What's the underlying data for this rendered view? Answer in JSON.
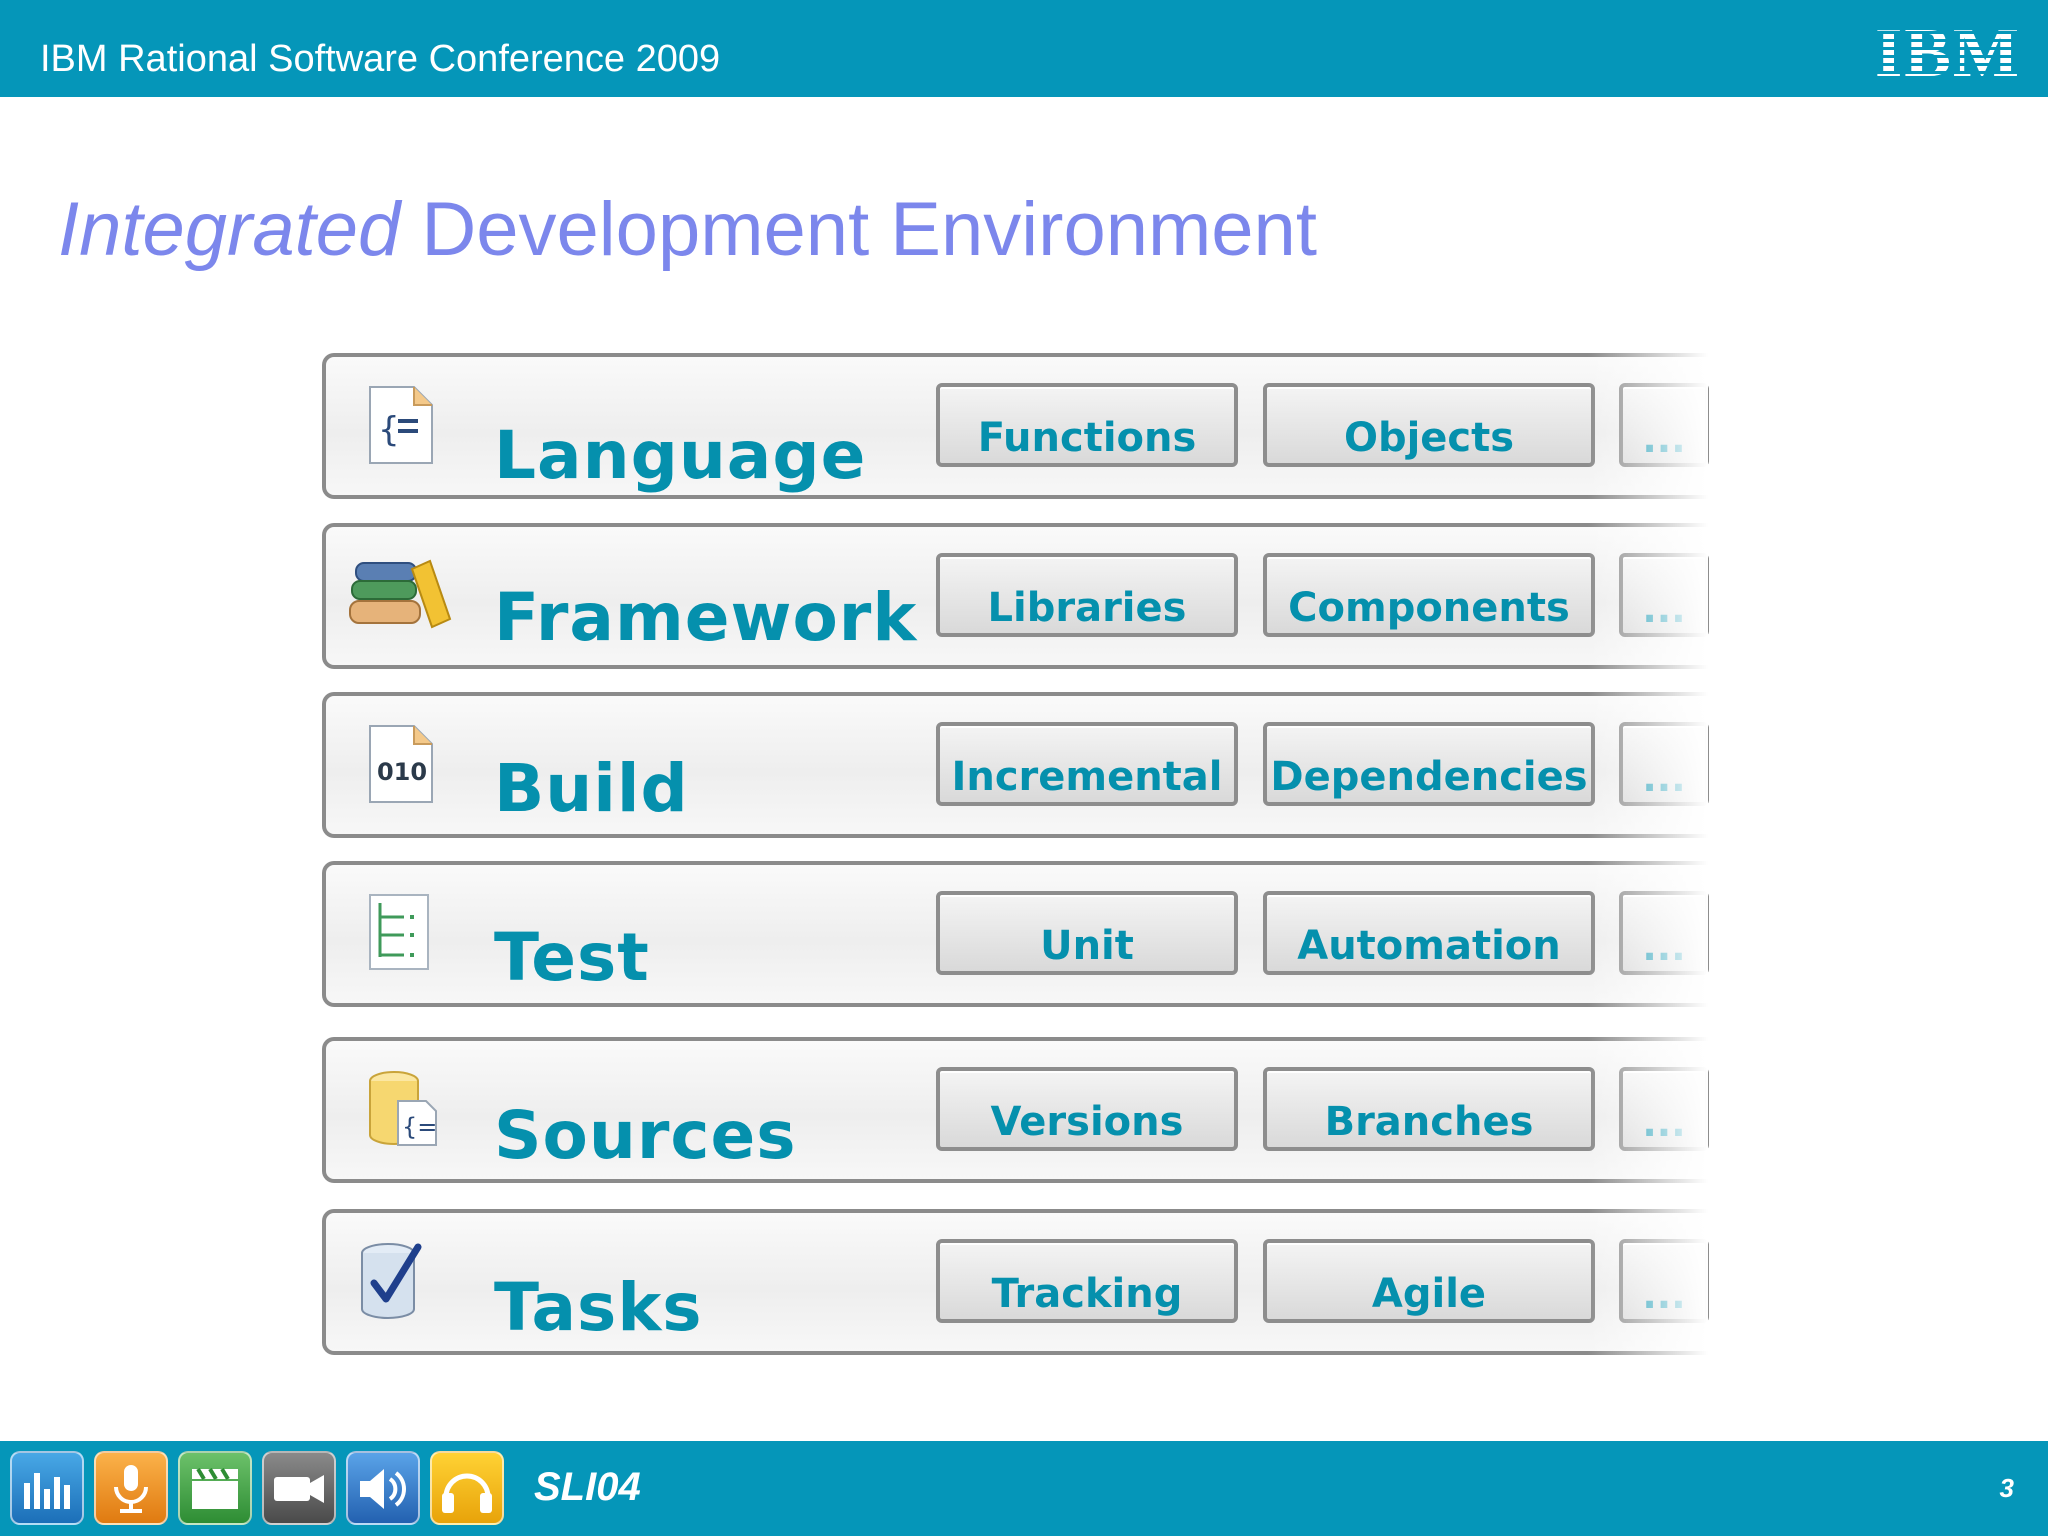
{
  "header": {
    "conference_title": "IBM Rational Software Conference 2009",
    "logo_text": "IBM"
  },
  "slide": {
    "title_italic": "Integrated",
    "title_rest": " Development Environment"
  },
  "rows": [
    {
      "label": "Language",
      "icon": "code-file-icon",
      "chips": [
        "Functions",
        "Objects",
        "..."
      ]
    },
    {
      "label": "Framework",
      "icon": "books-icon",
      "chips": [
        "Libraries",
        "Components",
        "..."
      ]
    },
    {
      "label": "Build",
      "icon": "binary-file-icon",
      "icon_text": "010",
      "chips": [
        "Incremental",
        "Dependencies",
        "..."
      ]
    },
    {
      "label": "Test",
      "icon": "test-tree-icon",
      "chips": [
        "Unit",
        "Automation",
        "..."
      ]
    },
    {
      "label": "Sources",
      "icon": "repository-icon",
      "chips": [
        "Versions",
        "Branches",
        "..."
      ]
    },
    {
      "label": "Tasks",
      "icon": "task-check-icon",
      "chips": [
        "Tracking",
        "Agile",
        "..."
      ]
    }
  ],
  "footer": {
    "session_code": "SLI04",
    "page_number": "3",
    "media_icons": [
      "equalizer-icon",
      "microphone-icon",
      "clapperboard-icon",
      "video-camera-icon",
      "speaker-icon",
      "headphones-icon"
    ]
  },
  "colors": {
    "bar": "#0596b9",
    "title": "#7c87ec",
    "accent": "#0590ad"
  }
}
